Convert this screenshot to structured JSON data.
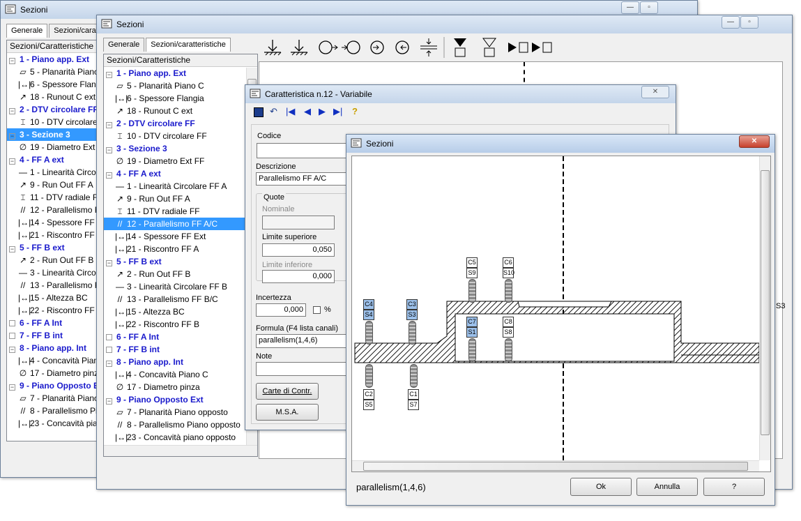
{
  "win_back": {
    "title": "Sezioni",
    "tabs": [
      "Generale",
      "Sezioni/caratteristiche"
    ],
    "tree_header": "Sezioni/Caratteristiche",
    "items": [
      {
        "t": "g",
        "label": "1 - Piano app. Ext"
      },
      {
        "t": "s",
        "icon": "▱",
        "label": "5 - Planarità Piano C"
      },
      {
        "t": "s",
        "icon": "|↔|",
        "label": "6 - Spessore Flangia"
      },
      {
        "t": "s",
        "icon": "↗",
        "label": "18 - Runout C ext"
      },
      {
        "t": "g",
        "label": "2 - DTV circolare FF"
      },
      {
        "t": "s",
        "icon": "⌶",
        "label": "10 - DTV circolare FF"
      },
      {
        "t": "g",
        "label": "3 - Sezione 3",
        "sel": true
      },
      {
        "t": "s",
        "icon": "∅",
        "label": "19 - Diametro Ext FF"
      },
      {
        "t": "g",
        "label": "4 - FF A ext"
      },
      {
        "t": "s",
        "icon": "—",
        "label": "1 - Linearità Circolare FF A"
      },
      {
        "t": "s",
        "icon": "↗",
        "label": "9 - Run Out FF A"
      },
      {
        "t": "s",
        "icon": "⌶",
        "label": "11 - DTV radiale FF"
      },
      {
        "t": "s",
        "icon": "//",
        "label": "12 - Parallelismo FF A/C"
      },
      {
        "t": "s",
        "icon": "|↔|",
        "label": "14 - Spessore FF Ext"
      },
      {
        "t": "s",
        "icon": "|↔|",
        "label": "21 - Riscontro FF A"
      },
      {
        "t": "g",
        "label": "5 - FF B ext"
      },
      {
        "t": "s",
        "icon": "↗",
        "label": "2 - Run Out FF B"
      },
      {
        "t": "s",
        "icon": "—",
        "label": "3 - Linearità Circolare FF B"
      },
      {
        "t": "s",
        "icon": "//",
        "label": "13 - Parallelismo FF B/C"
      },
      {
        "t": "s",
        "icon": "|↔|",
        "label": "15 - Altezza BC"
      },
      {
        "t": "s",
        "icon": "|↔|",
        "label": "22 - Riscontro FF B"
      },
      {
        "t": "g",
        "box": true,
        "label": "6 - FF A Int"
      },
      {
        "t": "g",
        "box": true,
        "label": "7 - FF B int"
      },
      {
        "t": "g",
        "label": "8 - Piano app. Int"
      },
      {
        "t": "s",
        "icon": "|↔|",
        "label": "4 - Concavità  Piano C"
      },
      {
        "t": "s",
        "icon": "∅",
        "label": "17 - Diametro pinza"
      },
      {
        "t": "g",
        "label": "9 - Piano Opposto Ext"
      },
      {
        "t": "s",
        "icon": "▱",
        "label": "7 - Planarità Piano opposto"
      },
      {
        "t": "s",
        "icon": "//",
        "label": "8 - Parallelismo Piano opposto"
      },
      {
        "t": "s",
        "icon": "|↔|",
        "label": "23 - Concavità piano opposto"
      }
    ]
  },
  "win_mid": {
    "title": "Sezioni",
    "tabs": [
      "Generale",
      "Sezioni/caratteristiche"
    ],
    "tree_header": "Sezioni/Caratteristiche",
    "items": [
      {
        "t": "g",
        "label": "1 - Piano app. Ext"
      },
      {
        "t": "s",
        "icon": "▱",
        "label": "5 - Planarità Piano C"
      },
      {
        "t": "s",
        "icon": "|↔|",
        "label": "6 - Spessore Flangia"
      },
      {
        "t": "s",
        "icon": "↗",
        "label": "18 - Runout C ext"
      },
      {
        "t": "g",
        "label": "2 - DTV circolare FF"
      },
      {
        "t": "s",
        "icon": "⌶",
        "label": "10 - DTV circolare FF"
      },
      {
        "t": "g",
        "label": "3 - Sezione 3"
      },
      {
        "t": "s",
        "icon": "∅",
        "label": "19 - Diametro Ext FF"
      },
      {
        "t": "g",
        "label": "4 - FF A ext"
      },
      {
        "t": "s",
        "icon": "—",
        "label": "1 - Linearità Circolare FF  A"
      },
      {
        "t": "s",
        "icon": "↗",
        "label": "9 - Run Out FF A"
      },
      {
        "t": "s",
        "icon": "⌶",
        "label": "11 - DTV radiale FF"
      },
      {
        "t": "s",
        "icon": "//",
        "label": "12 - Parallelismo FF A/C",
        "sel": true
      },
      {
        "t": "s",
        "icon": "|↔|",
        "label": "14 - Spessore FF Ext"
      },
      {
        "t": "s",
        "icon": "|↔|",
        "label": "21 - Riscontro FF A"
      },
      {
        "t": "g",
        "label": "5 - FF B ext"
      },
      {
        "t": "s",
        "icon": "↗",
        "label": "2 - Run Out FF B"
      },
      {
        "t": "s",
        "icon": "—",
        "label": "3 - Linearità Circolare FF B"
      },
      {
        "t": "s",
        "icon": "//",
        "label": "13 - Parallelismo FF B/C"
      },
      {
        "t": "s",
        "icon": "|↔|",
        "label": "15 - Altezza BC"
      },
      {
        "t": "s",
        "icon": "|↔|",
        "label": "22 - Riscontro FF B"
      },
      {
        "t": "g",
        "box": true,
        "label": "6 - FF A Int"
      },
      {
        "t": "g",
        "box": true,
        "label": "7 - FF B int"
      },
      {
        "t": "g",
        "label": "8 - Piano app. Int"
      },
      {
        "t": "s",
        "icon": "|↔|",
        "label": "4 - Concavità  Piano C"
      },
      {
        "t": "s",
        "icon": "∅",
        "label": "17 - Diametro pinza"
      },
      {
        "t": "g",
        "label": "9 - Piano Opposto Ext"
      },
      {
        "t": "s",
        "icon": "▱",
        "label": "7 - Planarità Piano opposto"
      },
      {
        "t": "s",
        "icon": "//",
        "label": "8 - Parallelismo Piano opposto"
      },
      {
        "t": "s",
        "icon": "|↔|",
        "label": "23 - Concavità piano opposto"
      }
    ],
    "right_label": "S3"
  },
  "char_dlg": {
    "title": "Caratteristica n.12 - Variabile",
    "codice_label": "Codice",
    "codice_value": "",
    "descrizione_label": "Descrizione",
    "descrizione_value": "Parallelismo FF A/C",
    "quote_label": "Quote",
    "nominale_label": "Nominale",
    "nominale_value": "",
    "lim_sup_label": "Limite superiore",
    "lim_sup_value": "0,050",
    "lim_inf_label": "Limite inferiore",
    "lim_inf_value": "0,000",
    "incertezza_label": "Incertezza",
    "incertezza_value": "0,000",
    "perc_label": "%",
    "formula_label": "Formula (F4 lista canali)",
    "formula_value": "parallelism(1,4,6)",
    "note_label": "Note",
    "note_value": "",
    "btn_carte": "Carte di Contr.",
    "btn_msa": "M.S.A."
  },
  "sez_dlg": {
    "title": "Sezioni",
    "status_text": "parallelism(1,4,6)",
    "ok": "Ok",
    "annulla": "Annulla",
    "help": "?",
    "sensors": [
      {
        "top": "C4",
        "bot": "S4",
        "blue": true
      },
      {
        "top": "C3",
        "bot": "S3",
        "blue": true
      },
      {
        "top": "C5",
        "bot": "S9"
      },
      {
        "top": "C6",
        "bot": "S10"
      },
      {
        "top": "C7",
        "bot": "S1",
        "blue": true
      },
      {
        "top": "C8",
        "bot": "S8"
      },
      {
        "top": "C2",
        "bot": "S5"
      },
      {
        "top": "C1",
        "bot": "S7"
      }
    ]
  }
}
